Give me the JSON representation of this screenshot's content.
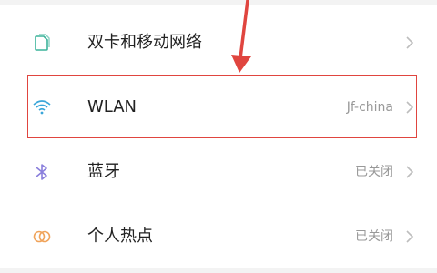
{
  "settings": {
    "items": [
      {
        "label": "双卡和移动网络",
        "value": "",
        "icon": "sim-card-icon",
        "icon_color": "#3bb39a"
      },
      {
        "label": "WLAN",
        "value": "Jf-china",
        "icon": "wifi-icon",
        "icon_color": "#3aa6d9"
      },
      {
        "label": "蓝牙",
        "value": "已关闭",
        "icon": "bluetooth-icon",
        "icon_color": "#8a7fdc"
      },
      {
        "label": "个人热点",
        "value": "已关闭",
        "icon": "hotspot-icon",
        "icon_color": "#f0a35a"
      }
    ]
  },
  "annotation": {
    "highlight_color": "#e0453f",
    "arrow_color": "#e0453f"
  }
}
